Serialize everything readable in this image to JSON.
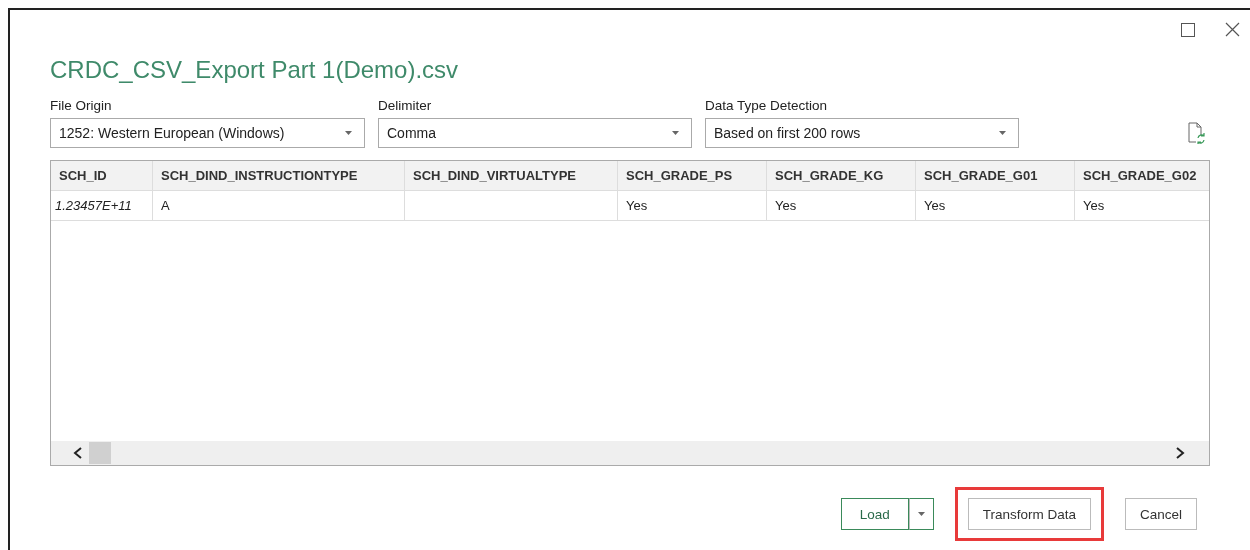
{
  "window": {
    "title": "CRDC_CSV_Export Part 1(Demo).csv"
  },
  "options": [
    {
      "label": "File Origin",
      "value": "1252: Western European (Windows)"
    },
    {
      "label": "Delimiter",
      "value": "Comma"
    },
    {
      "label": "Data Type Detection",
      "value": "Based on first 200 rows"
    }
  ],
  "table": {
    "columns": [
      "SCH_ID",
      "SCH_DIND_INSTRUCTIONTYPE",
      "SCH_DIND_VIRTUALTYPE",
      "SCH_GRADE_PS",
      "SCH_GRADE_KG",
      "SCH_GRADE_G01",
      "SCH_GRADE_G02"
    ],
    "rows": [
      [
        "1.23457E+11",
        "A",
        "",
        "Yes",
        "Yes",
        "Yes",
        "Yes"
      ]
    ]
  },
  "buttons": [
    {
      "label": "Load",
      "kind": "split",
      "highlighted": false
    },
    {
      "label": "Transform Data",
      "kind": "plain",
      "highlighted": true
    },
    {
      "label": "Cancel",
      "kind": "plain",
      "highlighted": false
    }
  ]
}
